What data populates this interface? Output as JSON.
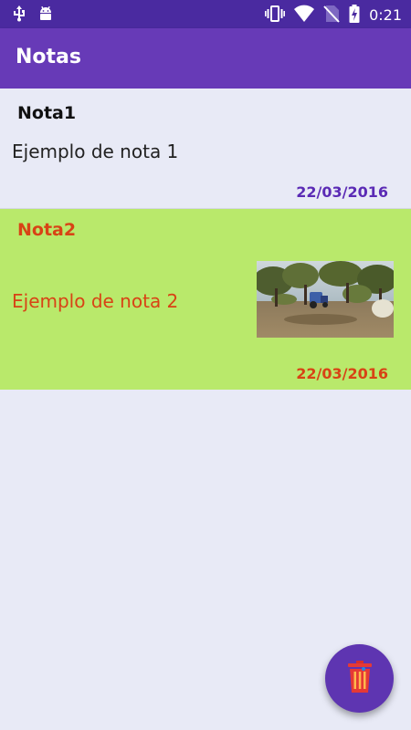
{
  "status_bar": {
    "time": "0:21",
    "left_icons": [
      "usb-icon",
      "android-debug-icon"
    ],
    "right_icons": [
      "vibrate-icon",
      "wifi-icon",
      "no-sim-icon",
      "battery-charging-icon"
    ]
  },
  "app_bar": {
    "title": "Notas"
  },
  "notes": [
    {
      "title": "Nota1",
      "body": "Ejemplo de nota 1",
      "date": "22/03/2016",
      "has_image": false
    },
    {
      "title": "Nota2",
      "body": "Ejemplo de nota 2",
      "date": "22/03/2016",
      "has_image": true,
      "image": "photo-thumbnail-icon"
    }
  ],
  "fab": {
    "icon": "trash-icon"
  },
  "colors": {
    "status_bar": "#4a2aa0",
    "app_bar": "#673ab7",
    "background": "#e8eaf6",
    "note2_background": "#b9e96b",
    "note1_date": "#5b2bb5",
    "note2_text": "#d84315",
    "fab": "#5e35b1",
    "trash": "#e53935"
  }
}
